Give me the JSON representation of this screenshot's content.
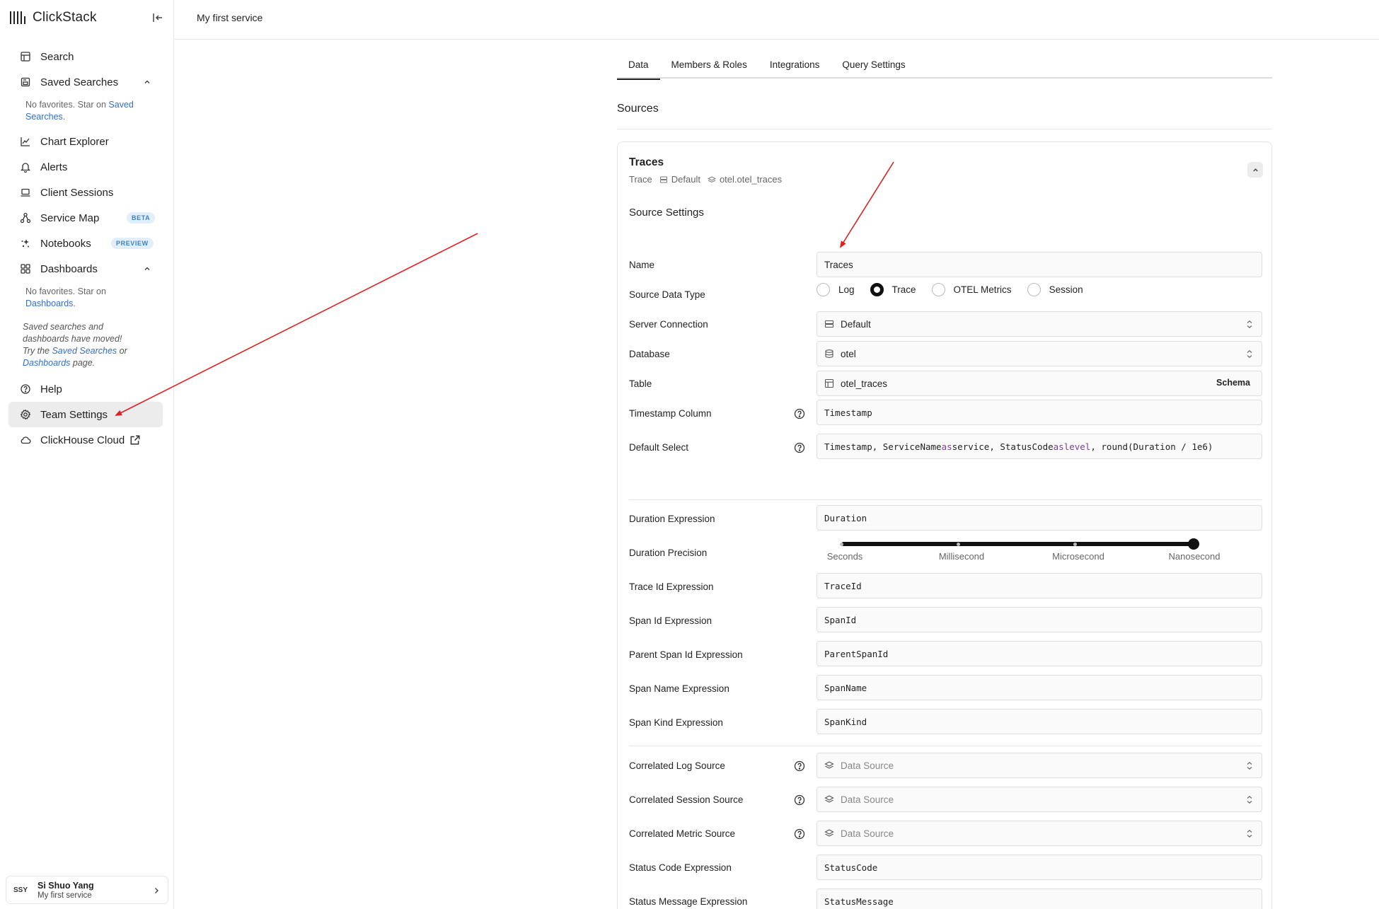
{
  "brand": {
    "name": "ClickStack"
  },
  "sidebar": {
    "items": [
      {
        "label": "Search"
      },
      {
        "label": "Saved Searches"
      },
      {
        "label": "Chart Explorer"
      },
      {
        "label": "Alerts"
      },
      {
        "label": "Client Sessions"
      },
      {
        "label": "Service Map",
        "badge": "BETA"
      },
      {
        "label": "Notebooks",
        "badge": "PREVIEW"
      },
      {
        "label": "Dashboards"
      },
      {
        "label": "Help"
      },
      {
        "label": "Team Settings"
      },
      {
        "label": "ClickHouse Cloud"
      }
    ],
    "saved_note": {
      "text": "No favorites. Star on ",
      "link": "Saved Searches",
      "end": "."
    },
    "dash_note": {
      "text": "No favorites. Star on ",
      "link": "Dashboards",
      "end": "."
    },
    "moved_note": {
      "p1": "Saved searches and dashboards have moved! Try the ",
      "link1": "Saved Searches",
      "p2": " or ",
      "link2": "Dashboards",
      "p3": " page."
    }
  },
  "user": {
    "initials": "SSY",
    "name": "Si Shuo Yang",
    "service": "My first service"
  },
  "header": {
    "title": "My first service"
  },
  "tabs": [
    {
      "label": "Data",
      "active": true
    },
    {
      "label": "Members & Roles"
    },
    {
      "label": "Integrations"
    },
    {
      "label": "Query Settings"
    }
  ],
  "sources": {
    "title": "Sources"
  },
  "card": {
    "title": "Traces",
    "meta": {
      "kind": "Trace",
      "connection": "Default",
      "table": "otel.otel_traces"
    },
    "settings_title": "Source Settings"
  },
  "form": {
    "name": {
      "label": "Name",
      "value": "Traces"
    },
    "data_type": {
      "label": "Source Data Type",
      "options": [
        "Log",
        "Trace",
        "OTEL Metrics",
        "Session"
      ],
      "selected": "Trace"
    },
    "server_connection": {
      "label": "Server Connection",
      "value": "Default"
    },
    "database": {
      "label": "Database",
      "value": "otel"
    },
    "table": {
      "label": "Table",
      "value": "otel_traces",
      "schema": "Schema"
    },
    "timestamp": {
      "label": "Timestamp Column",
      "value": "Timestamp"
    },
    "default_select": {
      "label": "Default Select",
      "p1": "Timestamp, ServiceName ",
      "k1": "as",
      "p2": " service, StatusCode ",
      "k2": "as",
      "p3": " ",
      "k3": "level",
      "p4": ", round(Duration / 1e6)"
    },
    "duration_expr": {
      "label": "Duration Expression",
      "value": "Duration"
    },
    "duration_precision": {
      "label": "Duration Precision",
      "ticks": [
        "Seconds",
        "Millisecond",
        "Microsecond",
        "Nanosecond"
      ],
      "selected": "Nanosecond"
    },
    "trace_id": {
      "label": "Trace Id Expression",
      "value": "TraceId"
    },
    "span_id": {
      "label": "Span Id Expression",
      "value": "SpanId"
    },
    "parent_span": {
      "label": "Parent Span Id Expression",
      "value": "ParentSpanId"
    },
    "span_name": {
      "label": "Span Name Expression",
      "value": "SpanName"
    },
    "span_kind": {
      "label": "Span Kind Expression",
      "value": "SpanKind"
    },
    "corr_log": {
      "label": "Correlated Log Source",
      "placeholder": "Data Source"
    },
    "corr_session": {
      "label": "Correlated Session Source",
      "placeholder": "Data Source"
    },
    "corr_metric": {
      "label": "Correlated Metric Source",
      "placeholder": "Data Source"
    },
    "status_code": {
      "label": "Status Code Expression",
      "value": "StatusCode"
    },
    "status_message": {
      "label": "Status Message Expression",
      "value": "StatusMessage"
    }
  },
  "annotation_color": "#e0201f"
}
